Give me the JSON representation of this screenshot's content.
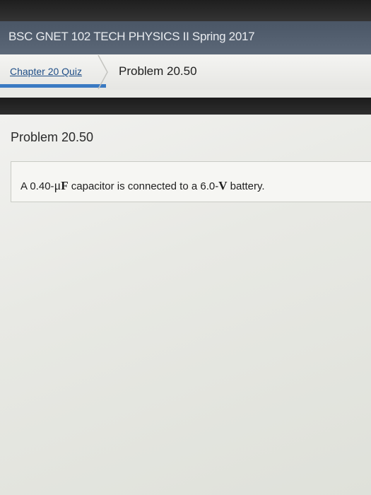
{
  "header": {
    "course_title": "BSC GNET 102 TECH PHYSICS II Spring 2017"
  },
  "breadcrumb": {
    "parent_label": "Chapter 20 Quiz",
    "current_label": "Problem 20.50"
  },
  "problem": {
    "heading": "Problem 20.50",
    "text_prefix": "A 0.40-",
    "text_mu": "μ",
    "text_unit_f": "F",
    "text_middle": " capacitor is connected to a 6.0-",
    "text_unit_v": "V",
    "text_suffix": " battery."
  }
}
